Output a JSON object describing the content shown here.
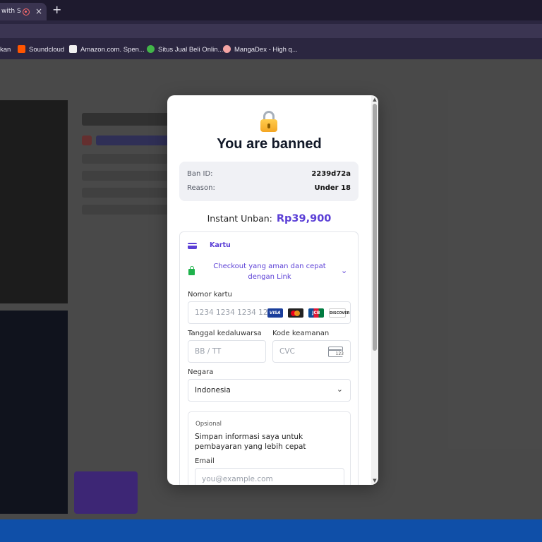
{
  "browser": {
    "tab_title": "with S",
    "tab_close": "×",
    "new_tab": "+",
    "bookmarks": [
      {
        "label": "kan",
        "icon": "bookmark-icon"
      },
      {
        "label": "Soundcloud",
        "icon": "soundcloud-icon"
      },
      {
        "label": "Amazon.com. Spen...",
        "icon": "amazon-icon"
      },
      {
        "label": "Situs Jual Beli Onlin...",
        "icon": "tokopedia-icon"
      },
      {
        "label": "MangaDex - High q...",
        "icon": "mangadex-icon"
      }
    ]
  },
  "modal": {
    "icon": "lock-icon",
    "title": "You are banned",
    "ban_id_label": "Ban ID:",
    "ban_id": "2239d72a",
    "reason_label": "Reason:",
    "reason": "Under 18",
    "unban_label": "Instant Unban:",
    "unban_price": "Rp39,900",
    "accent_color": "#5b3fd6"
  },
  "payment": {
    "method_label": "Kartu",
    "link_text": "Checkout yang aman dan cepat dengan Link",
    "card_number_label": "Nomor kartu",
    "card_number_placeholder": "1234 1234 1234 1234",
    "card_brands": [
      "VISA",
      "Mastercard",
      "JCB",
      "DISCOVER"
    ],
    "expiry_label": "Tanggal kedaluwarsa",
    "expiry_placeholder": "BB / TT",
    "cvc_label": "Kode keamanan",
    "cvc_placeholder": "CVC",
    "cvc_icon_text": "123",
    "country_label": "Negara",
    "country_value": "Indonesia",
    "optional_tag": "Opsional",
    "save_info_text": "Simpan informasi saya untuk pembayaran yang lebih cepat",
    "email_label": "Email",
    "email_placeholder": "you@example.com"
  }
}
